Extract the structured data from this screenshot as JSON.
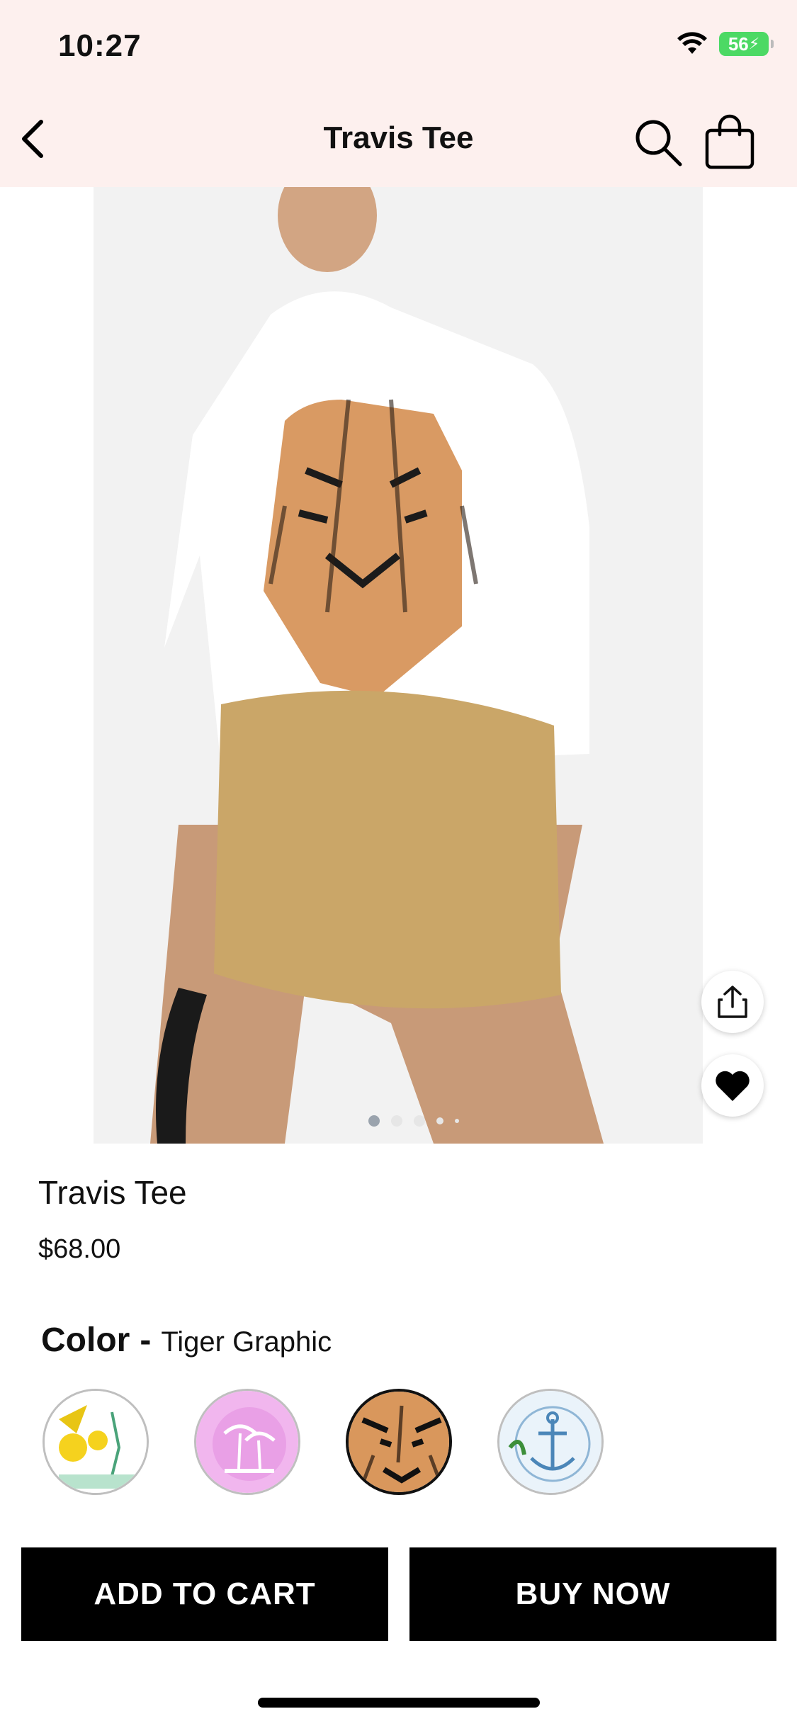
{
  "status_bar": {
    "time": "10:27",
    "battery": "56"
  },
  "nav": {
    "title": "Travis Tee",
    "icons": [
      "back-chevron-icon",
      "search-icon",
      "shopping-bag-icon"
    ]
  },
  "carousel": {
    "image_count": 5,
    "current_index": 1,
    "actions": [
      "share-icon",
      "heart-icon"
    ]
  },
  "product": {
    "name": "Travis Tee",
    "price": "$68.00"
  },
  "color": {
    "label": "Color",
    "separator": "-",
    "selected": "Tiger Graphic"
  },
  "swatch_count": 4,
  "swatch_selected_index": 3,
  "buttons": {
    "add_to_cart": "ADD TO CART",
    "buy_now": "BUY NOW"
  },
  "colors": {
    "topbar_bg": "#fdf0ee",
    "button_bg": "#000000",
    "battery_green": "#4cd964"
  }
}
